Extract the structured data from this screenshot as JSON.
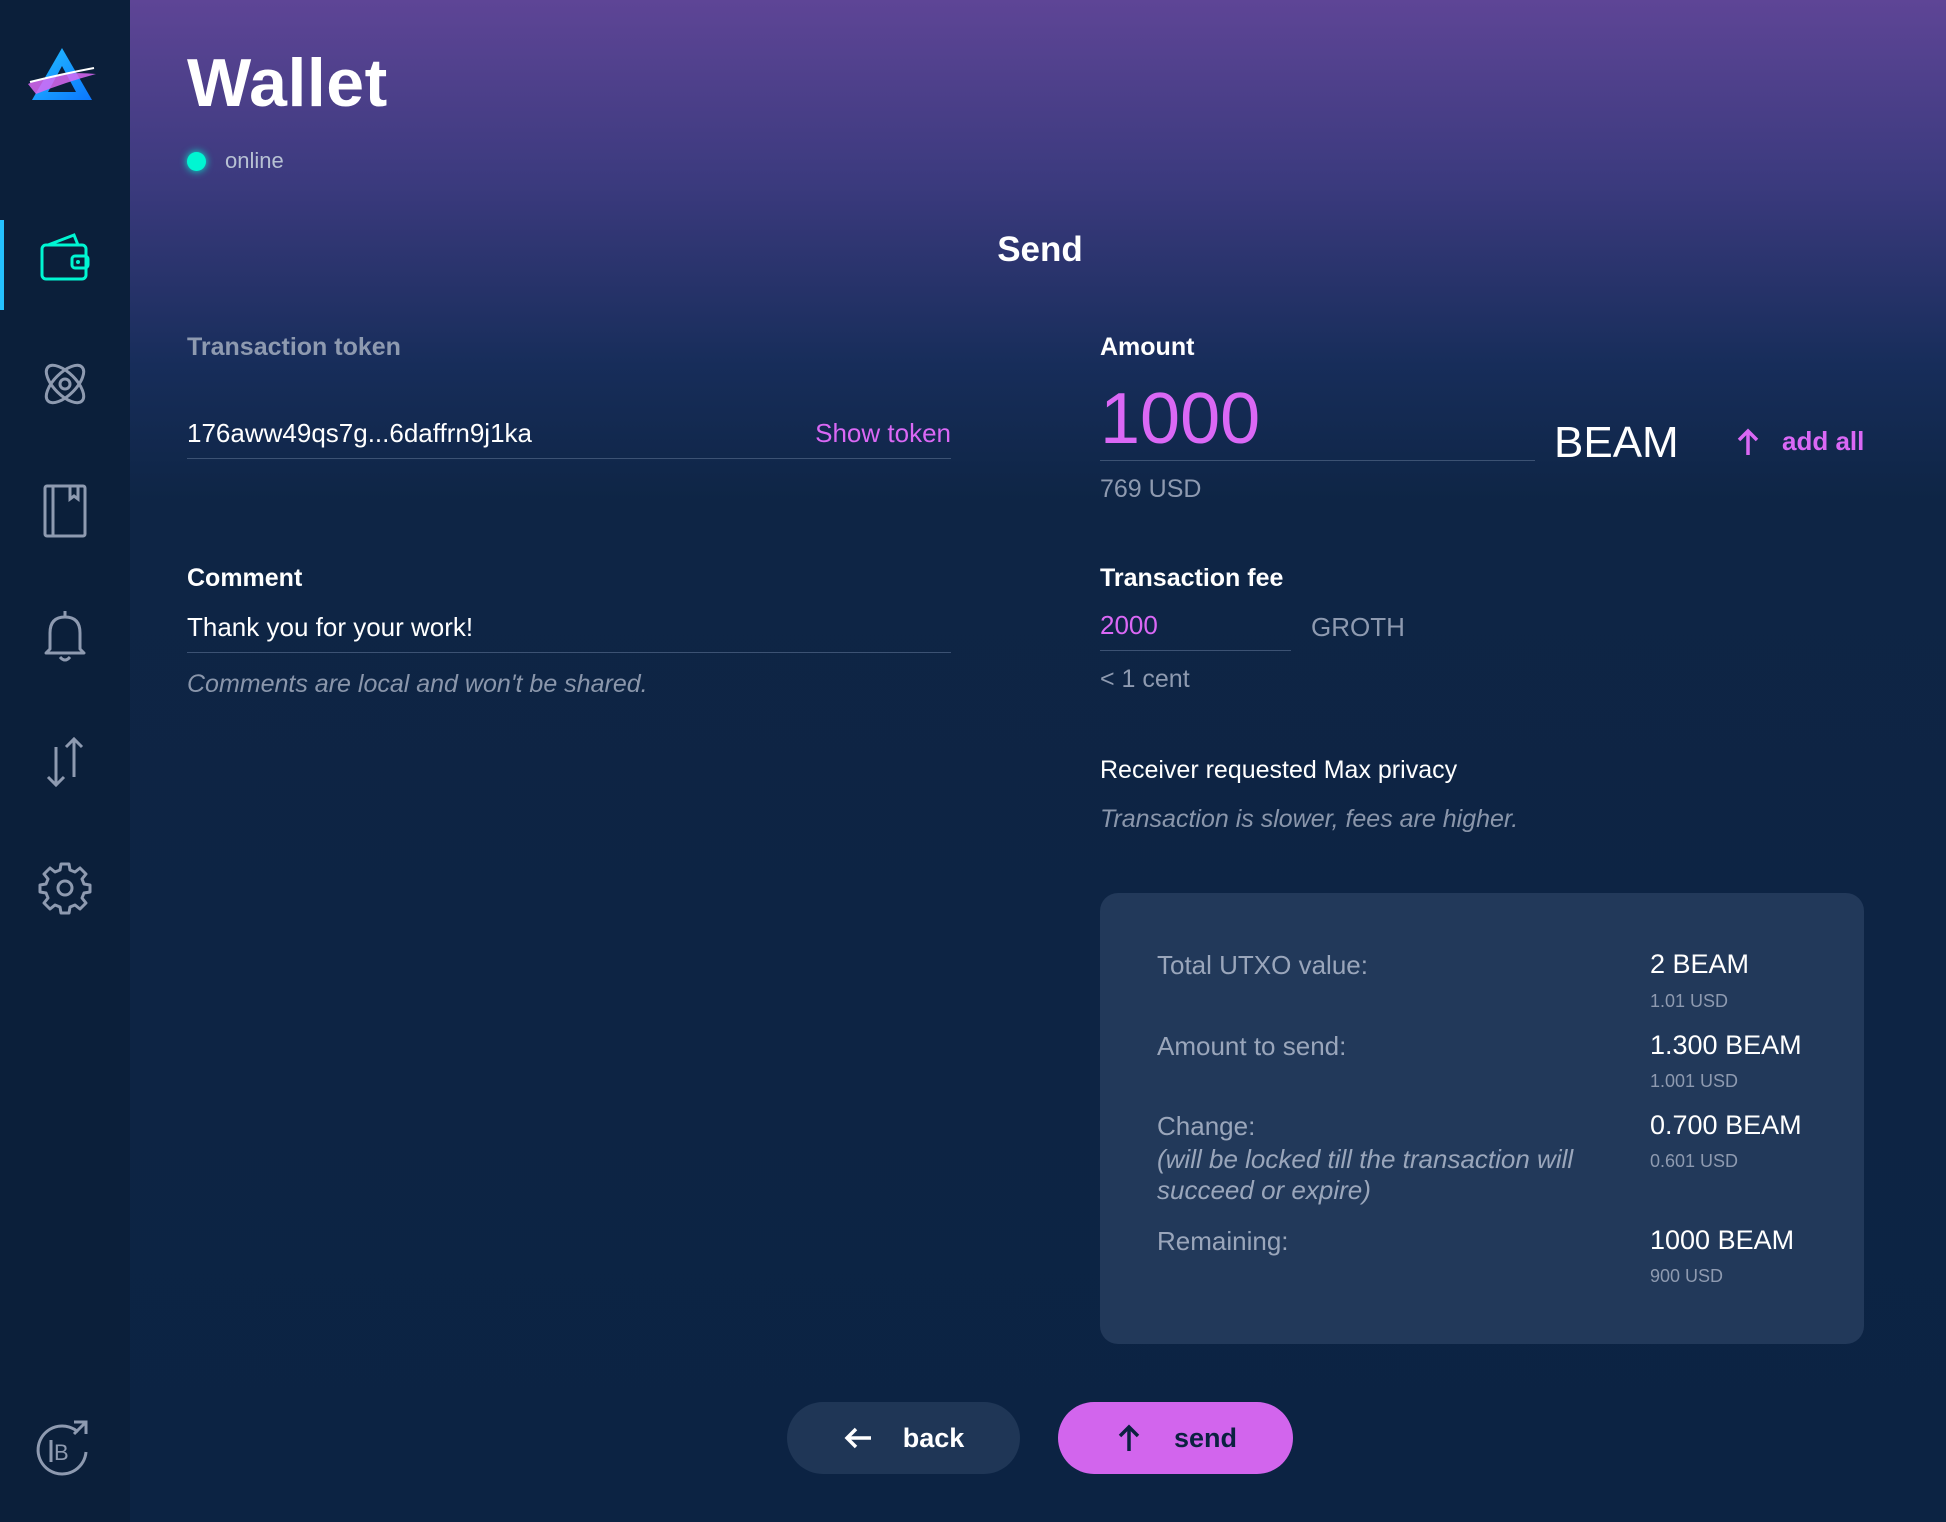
{
  "app": {
    "title": "Wallet",
    "status": "online"
  },
  "sidebar": {
    "items": [
      {
        "icon": "wallet-icon",
        "active": true
      },
      {
        "icon": "atom-icon",
        "active": false
      },
      {
        "icon": "address-book-icon",
        "active": false
      },
      {
        "icon": "bell-icon",
        "active": false
      },
      {
        "icon": "transfer-icon",
        "active": false
      },
      {
        "icon": "gear-icon",
        "active": false
      }
    ],
    "bottom_icon": "external-link-icon"
  },
  "page": {
    "heading": "Send"
  },
  "token": {
    "label": "Transaction token",
    "value": "176aww49qs7g...6daffrn9j1ka",
    "show_label": "Show token"
  },
  "comment": {
    "label": "Comment",
    "value": "Thank you for your work!",
    "note": "Comments are local and won't be shared."
  },
  "amount": {
    "label": "Amount",
    "value": "1000",
    "unit": "BEAM",
    "add_all_label": "add all",
    "usd": "769 USD"
  },
  "fee": {
    "label": "Transaction fee",
    "value": "2000",
    "unit": "GROTH",
    "usd": "< 1 cent"
  },
  "privacy": {
    "title": "Receiver requested Max privacy",
    "note": "Transaction is slower, fees are higher."
  },
  "summary": {
    "total_utxo": {
      "label": "Total UTXO value:",
      "value": "2 BEAM",
      "usd": "1.01 USD"
    },
    "amount_to_send": {
      "label": "Amount to send:",
      "value": "1.300 BEAM",
      "usd": "1.001 USD"
    },
    "change": {
      "label": "Change:",
      "sub": "(will be locked till the transaction will succeed or expire)",
      "value": "0.700 BEAM",
      "usd": "0.601 USD"
    },
    "remaining": {
      "label": "Remaining:",
      "value": "1000 BEAM",
      "usd": "900 USD"
    }
  },
  "buttons": {
    "back": "back",
    "send": "send"
  },
  "colors": {
    "accent": "#da68f5",
    "status": "#00f6d2",
    "active_nav": "#24c1ff",
    "background": "#0b2140"
  }
}
